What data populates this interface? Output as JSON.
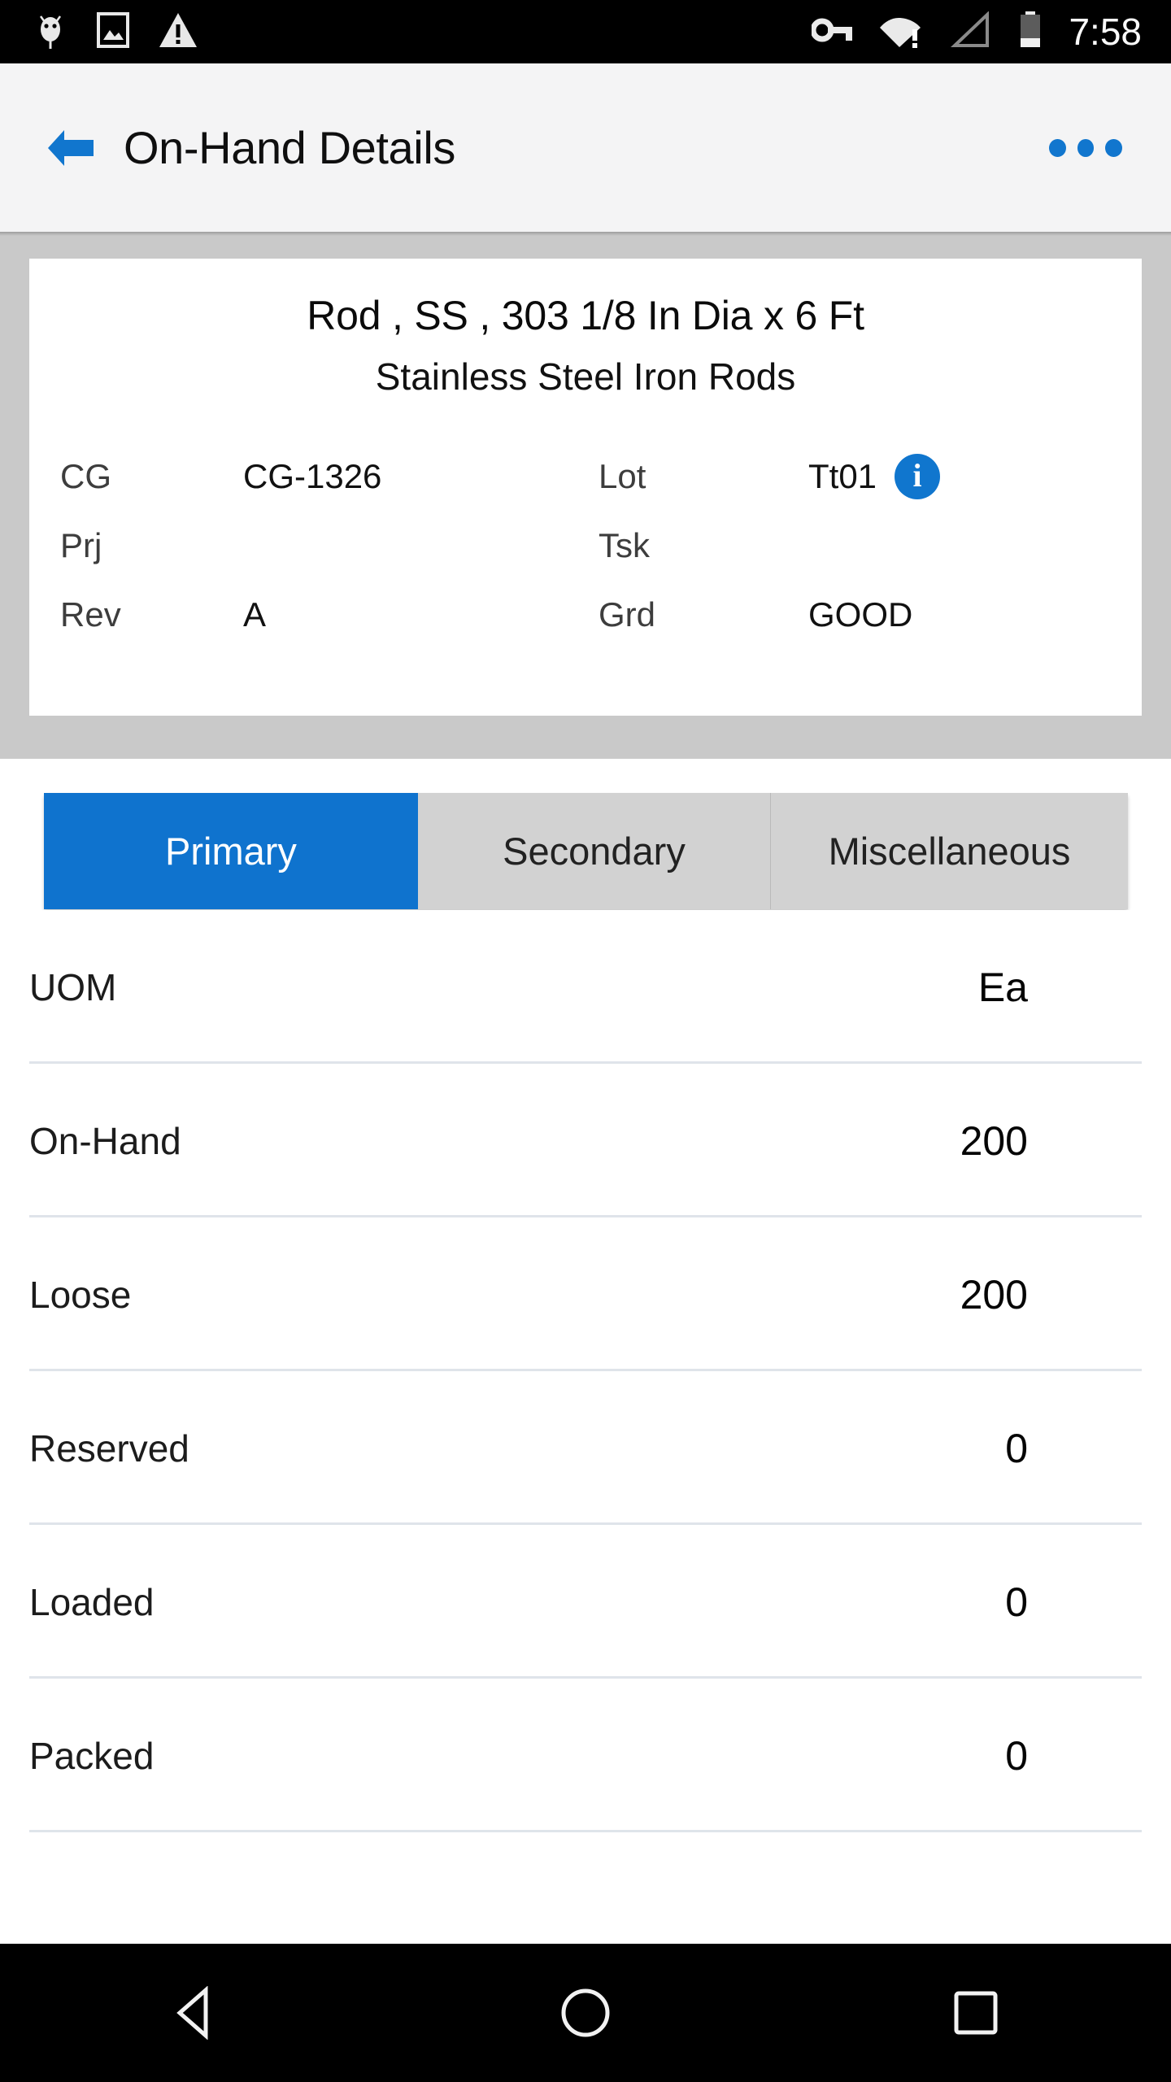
{
  "status_bar": {
    "time": "7:58",
    "left_icons": [
      "bug-icon",
      "image-icon",
      "warning-icon"
    ],
    "right_icons": [
      "vpn-key-icon",
      "wifi-alert-icon",
      "cellular-signal-icon",
      "battery-icon"
    ]
  },
  "app_bar": {
    "back_label": "back-arrow",
    "title": "On-Hand Details",
    "overflow_label": "overflow-menu"
  },
  "info_card": {
    "title": "Rod , SS , 303 1/8 In Dia x 6 Ft",
    "subtitle": "Stainless Steel Iron Rods",
    "fields": [
      {
        "label": "CG",
        "value": "CG-1326",
        "label2": "Lot",
        "value2": "Tt01",
        "has_info": true
      },
      {
        "label": "Prj",
        "value": "",
        "label2": "Tsk",
        "value2": "",
        "has_info": false
      },
      {
        "label": "Rev",
        "value": "A",
        "label2": "Grd",
        "value2": "GOOD",
        "has_info": false
      }
    ]
  },
  "tabs": {
    "items": [
      {
        "label": "Primary",
        "active": true
      },
      {
        "label": "Secondary",
        "active": false
      },
      {
        "label": "Miscellaneous",
        "active": false
      }
    ]
  },
  "detail_list": {
    "rows": [
      {
        "label": "UOM",
        "value": "Ea"
      },
      {
        "label": "On-Hand",
        "value": "200"
      },
      {
        "label": "Loose",
        "value": "200"
      },
      {
        "label": "Reserved",
        "value": "0"
      },
      {
        "label": "Loaded",
        "value": "0"
      },
      {
        "label": "Packed",
        "value": "0"
      }
    ]
  },
  "nav_bar": {
    "back": "nav-back",
    "home": "nav-home",
    "recents": "nav-recents"
  },
  "colors": {
    "accent_blue": "#0f73ce",
    "status_bar_bg": "#000000",
    "app_bar_bg": "#f4f4f5",
    "card_region_bg": "#c9c9c9",
    "tab_inactive_bg": "#d2d2d2",
    "divider": "#dfe4ea"
  }
}
